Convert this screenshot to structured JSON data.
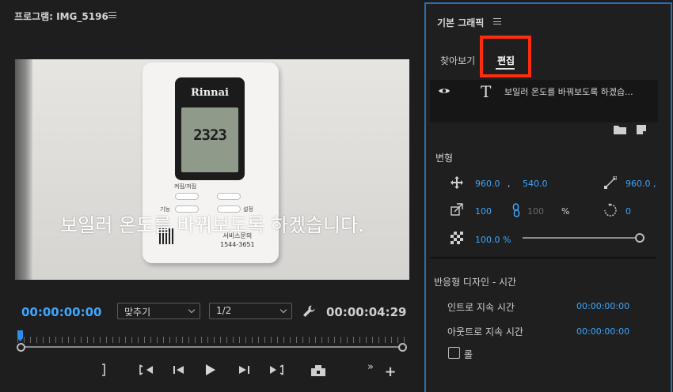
{
  "program": {
    "title": "프로그램: IMG_5196",
    "caption": "보일러 온도를 바꿔보도록 하겠습니다.",
    "thermostat": {
      "brand": "Rinnai",
      "temp": "2323",
      "labels": [
        "켜짐/꺼짐",
        "기능",
        "설정"
      ],
      "service": "서비스문의",
      "phone": "1544-3651"
    },
    "timecode_current": "00:00:00:00",
    "fit": "맞추기",
    "resolution": "1/2",
    "timecode_duration": "00:00:04:29",
    "playhead_fraction": 0
  },
  "essential_graphics": {
    "title": "기본 그래픽",
    "tabs": {
      "browse": "찾아보기",
      "edit": "편집"
    },
    "highlight_color": "#ff2d10",
    "layer": {
      "icon": "T",
      "name": "보일러 온도를 바꿔보도록 하겠습..."
    },
    "transform": {
      "section": "변형",
      "pos_x": "960.0",
      "pos_y": "540.0",
      "comma": ",",
      "anchor_x": "960.0 ,",
      "scale": "100",
      "scale_h": "100",
      "percent": "%",
      "rotation": "0",
      "opacity": "100.0 %",
      "opacity_fraction": 1
    },
    "responsive": {
      "section": "반응형 디자인 - 시간",
      "intro_label": "인트로 지속 시간",
      "intro_value": "00:00:00:00",
      "outro_label": "아웃트로 지속 시간",
      "outro_value": "00:00:00:00",
      "roll_label": "롤"
    }
  },
  "colors": {
    "accent": "#3ea8ff",
    "panel_border": "#2b6db8"
  }
}
